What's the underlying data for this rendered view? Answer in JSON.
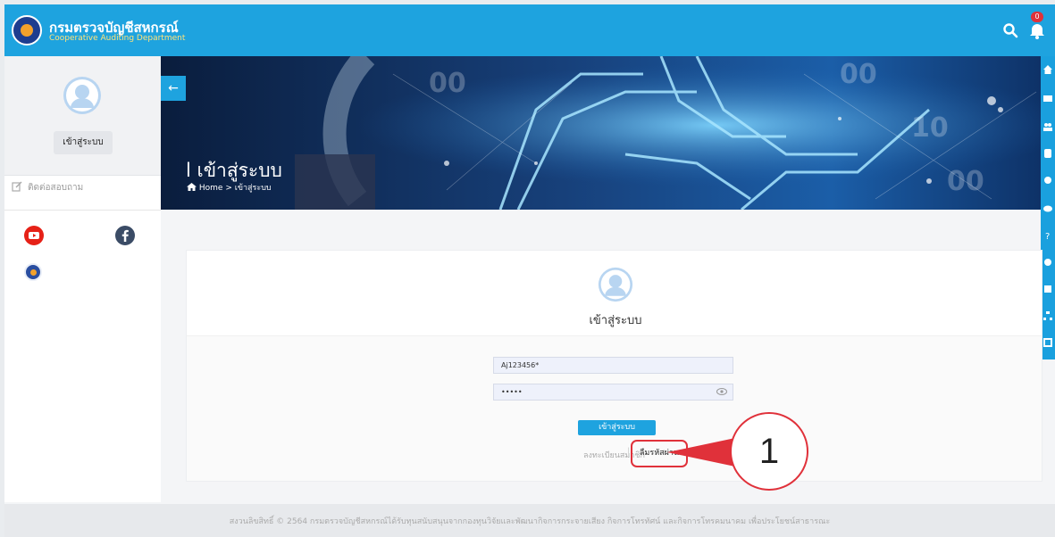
{
  "header": {
    "brand_th": "กรมตรวจบัญชีสหกรณ์",
    "brand_en": "Cooperative Auditing Department",
    "notification_count": "0"
  },
  "sidebar": {
    "login_button": "เข้าสู่ระบบ",
    "contact_label": "ติดต่อสอบถาม"
  },
  "banner": {
    "title": "l เข้าสู่ระบบ",
    "back_label": "←",
    "breadcrumb": {
      "home": "Home",
      "separator": ">",
      "current": "เข้าสู่ระบบ"
    }
  },
  "login": {
    "title": "เข้าสู่ระบบ",
    "username_value": "Aj123456*",
    "password_value": "•••••",
    "submit_label": "เข้าสู่ระบบ",
    "register_link": "ลงทะเบียนสมาชิก",
    "separator": "|",
    "forgot_link": "ลืมรหัสผ่าน"
  },
  "annotation": {
    "number": "1",
    "color": "#e0313a"
  },
  "footer": {
    "text": "สงวนลิขสิทธิ์ © 2564 กรมตรวจบัญชีสหกรณ์ได้รับทุนสนับสนุนจากกองทุนวิจัยและพัฒนากิจการกระจายเสียง กิจการโทรทัศน์ และกิจการโทรคมนาคม เพื่อประโยชน์สาธารณะ"
  },
  "colors": {
    "primary": "#1ea3df",
    "banner_dark": "#0a1d3d",
    "accent_red": "#e0313a"
  },
  "icons": {
    "header": [
      "search-icon",
      "bell-icon"
    ],
    "sidebar": [
      "user-avatar-icon",
      "edit-icon",
      "youtube-icon",
      "facebook-icon",
      "cad-logo-icon"
    ],
    "rail": [
      "home-icon",
      "folder-icon",
      "users-icon",
      "database-icon",
      "settings-icon",
      "chat-icon",
      "question-icon",
      "comment-icon",
      "book-icon",
      "sitemap-icon",
      "report-icon"
    ]
  }
}
